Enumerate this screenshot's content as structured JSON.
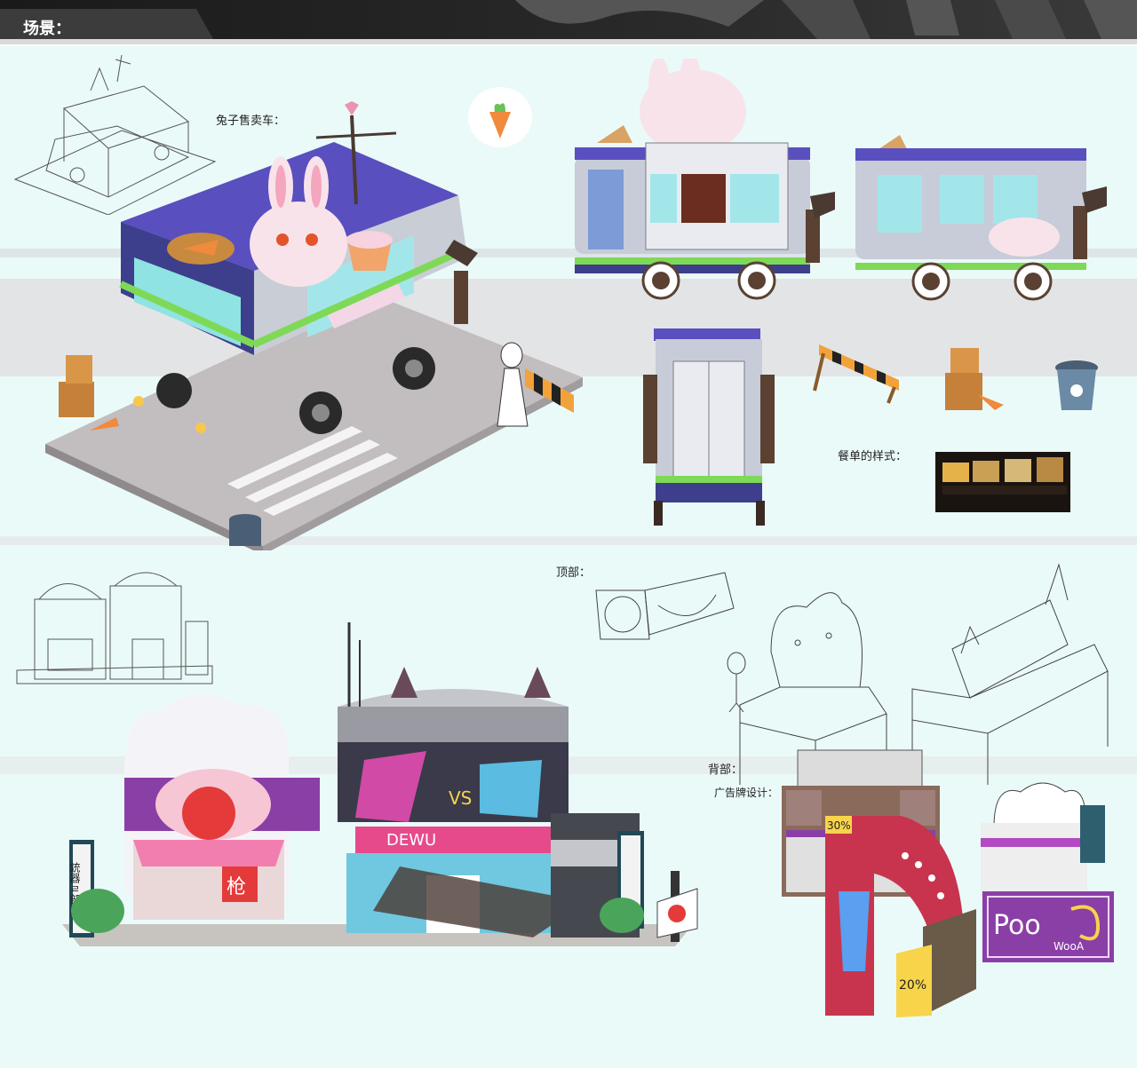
{
  "header": {
    "title": "场景："
  },
  "sections": {
    "food_truck": {
      "label": "兔子售卖车："
    },
    "menu": {
      "label": "餐单的样式："
    },
    "top_view": {
      "label": "顶部："
    },
    "back_view": {
      "label": "背部："
    },
    "billboard": {
      "label": "广告牌设计："
    }
  },
  "signs": {
    "dewu": "DEWU",
    "vs": "VS",
    "percent30": "30%",
    "percent20": "20%",
    "gun_shop_vertical": "銃器ㄹ部屋",
    "gun_char": "枪",
    "pooa": "Poo",
    "wooa": "WooA"
  },
  "colors": {
    "panel_bg": "#eafaf9",
    "truck_body": "#c9cdd6",
    "truck_roof": "#5a4fbf",
    "accent_green": "#7ed957",
    "accent_purple": "#8a3fa6",
    "accent_pink": "#f6c6d4"
  }
}
